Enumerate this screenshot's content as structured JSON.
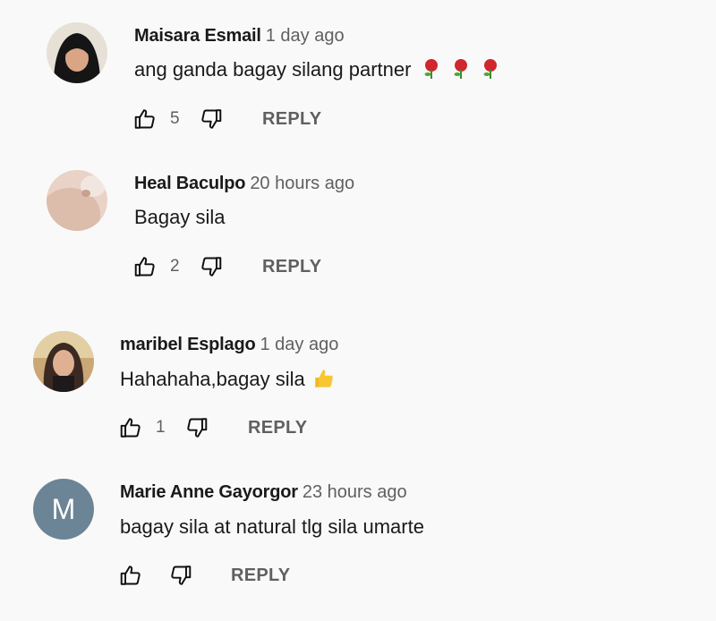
{
  "comments": [
    {
      "author": "Maisara Esmail",
      "time": "1 day ago",
      "text": "ang ganda bagay silang partner",
      "emoji": "rose-emoji x3",
      "likes": "5",
      "reply_label": "REPLY"
    },
    {
      "author": "Heal Baculpo",
      "time": "20 hours ago",
      "text": "Bagay sila",
      "likes": "2",
      "reply_label": "REPLY"
    },
    {
      "author": "maribel Esplago",
      "time": "1 day ago",
      "text": "Hahahaha,bagay sila",
      "emoji": "thumbs-up-emoji",
      "likes": "1",
      "reply_label": "REPLY"
    },
    {
      "author": "Marie Anne Gayorgor",
      "time": "23 hours ago",
      "text": "bagay sila at natural tlg sila umarte",
      "avatar_letter": "M",
      "avatar_color": "#6c8596",
      "reply_label": "REPLY"
    }
  ],
  "colors": {
    "background": "#f9f9f9",
    "secondary_text": "#606060",
    "primary_text": "#1a1a1a"
  }
}
